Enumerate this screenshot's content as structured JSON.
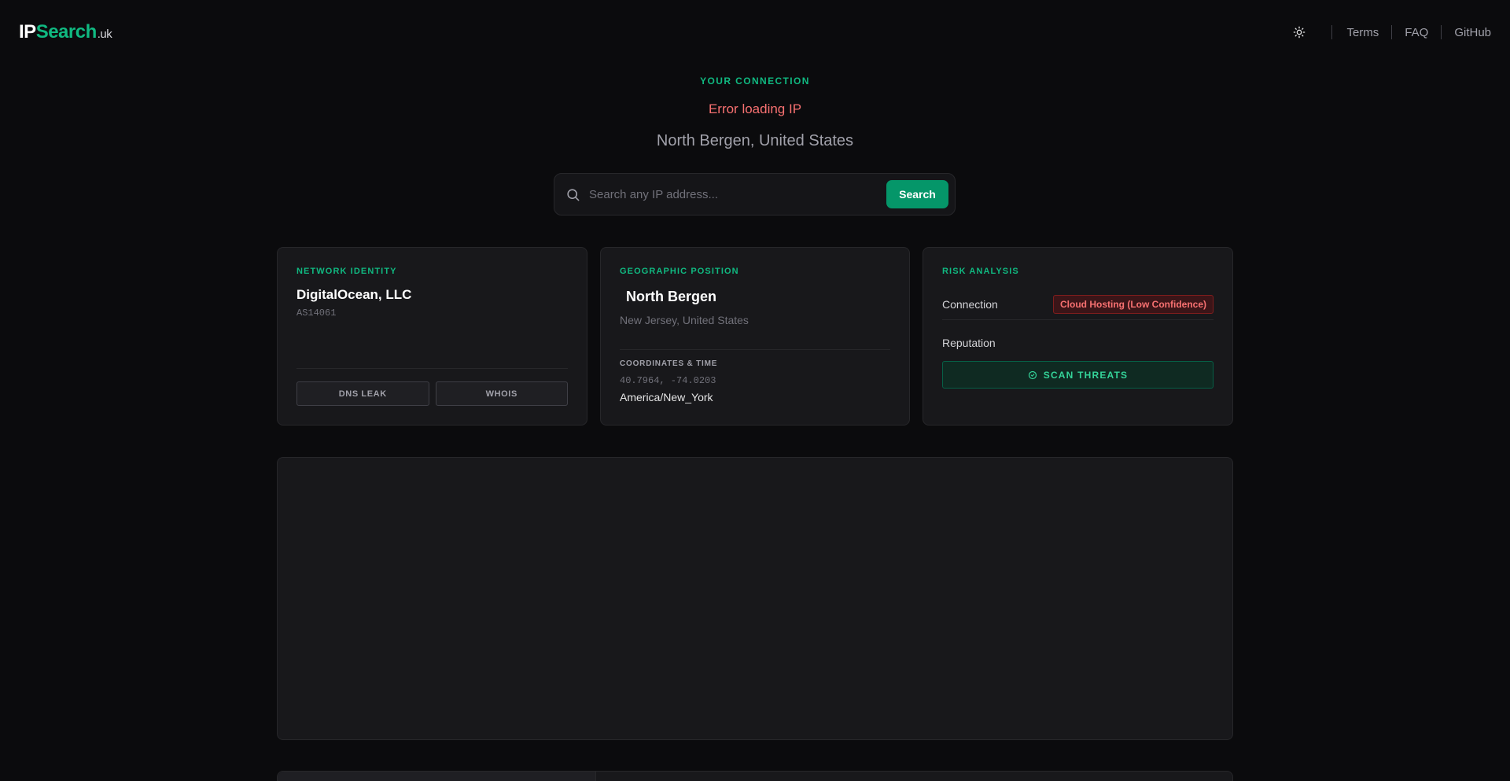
{
  "header": {
    "logo": {
      "ip": "IP",
      "search": "Search",
      "tld": ".uk"
    },
    "theme_icon": "sun-icon",
    "nav": {
      "terms": "Terms",
      "faq": "FAQ",
      "github": "GitHub"
    }
  },
  "hero": {
    "label": "YOUR CONNECTION",
    "error": "Error loading IP",
    "location": "North Bergen, United States"
  },
  "search": {
    "icon": "search-icon",
    "placeholder": "Search any IP address...",
    "value": "",
    "button_label": "Search"
  },
  "network": {
    "title": "NETWORK IDENTITY",
    "org": "DigitalOcean, LLC",
    "asn": "AS14061",
    "buttons": {
      "dns_leak": "DNS LEAK",
      "whois": "WHOIS"
    }
  },
  "geo": {
    "title": "GEOGRAPHIC POSITION",
    "city": "North Bergen",
    "region": "New Jersey, United States",
    "coords_label": "COORDINATES & TIME",
    "coords": "40.7964, -74.0203",
    "timezone": "America/New_York"
  },
  "risk": {
    "title": "RISK ANALYSIS",
    "connection_label": "Connection",
    "connection_badge": "Cloud Hosting (Low Confidence)",
    "reputation_label": "Reputation",
    "scan_button": "SCAN THREATS",
    "scan_icon": "shield-check-icon"
  },
  "colors": {
    "accent": "#10b981",
    "button": "#059669",
    "error": "#f87171",
    "background": "#0b0b0d",
    "card": "#18181b"
  }
}
